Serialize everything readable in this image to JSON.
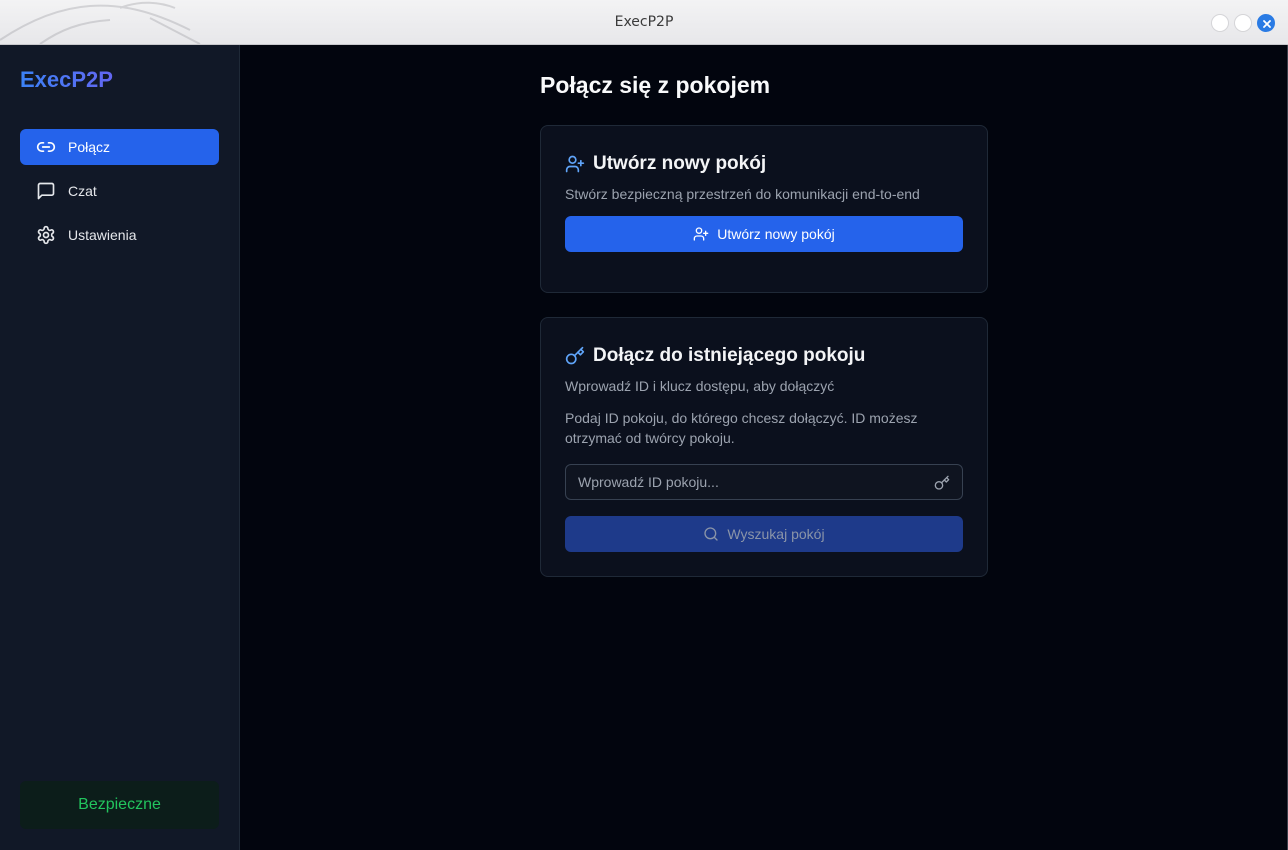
{
  "window": {
    "title": "ExecP2P"
  },
  "sidebar": {
    "brand": "ExecP2P",
    "items": [
      {
        "label": "Połącz",
        "icon": "link-icon",
        "active": true
      },
      {
        "label": "Czat",
        "icon": "chat-icon",
        "active": false
      },
      {
        "label": "Ustawienia",
        "icon": "gear-icon",
        "active": false
      }
    ],
    "status": "Bezpieczne"
  },
  "main": {
    "title": "Połącz się z pokojem",
    "create_card": {
      "title": "Utwórz nowy pokój",
      "description": "Stwórz bezpieczną przestrzeń do komunikacji end-to-end",
      "button_label": "Utwórz nowy pokój"
    },
    "join_card": {
      "title": "Dołącz do istniejącego pokoju",
      "description": "Wprowadź ID i klucz dostępu, aby dołączyć",
      "help": "Podaj ID pokoju, do którego chcesz dołączyć. ID możesz otrzymać od twórcy pokoju.",
      "input_placeholder": "Wprowadź ID pokoju...",
      "input_value": "",
      "button_label": "Wyszukaj pokój"
    }
  },
  "colors": {
    "accent": "#2563eb",
    "accent_disabled": "#1e3a8a",
    "sidebar_bg": "#111827",
    "main_bg": "#02050e",
    "status_green": "#22c55e"
  }
}
